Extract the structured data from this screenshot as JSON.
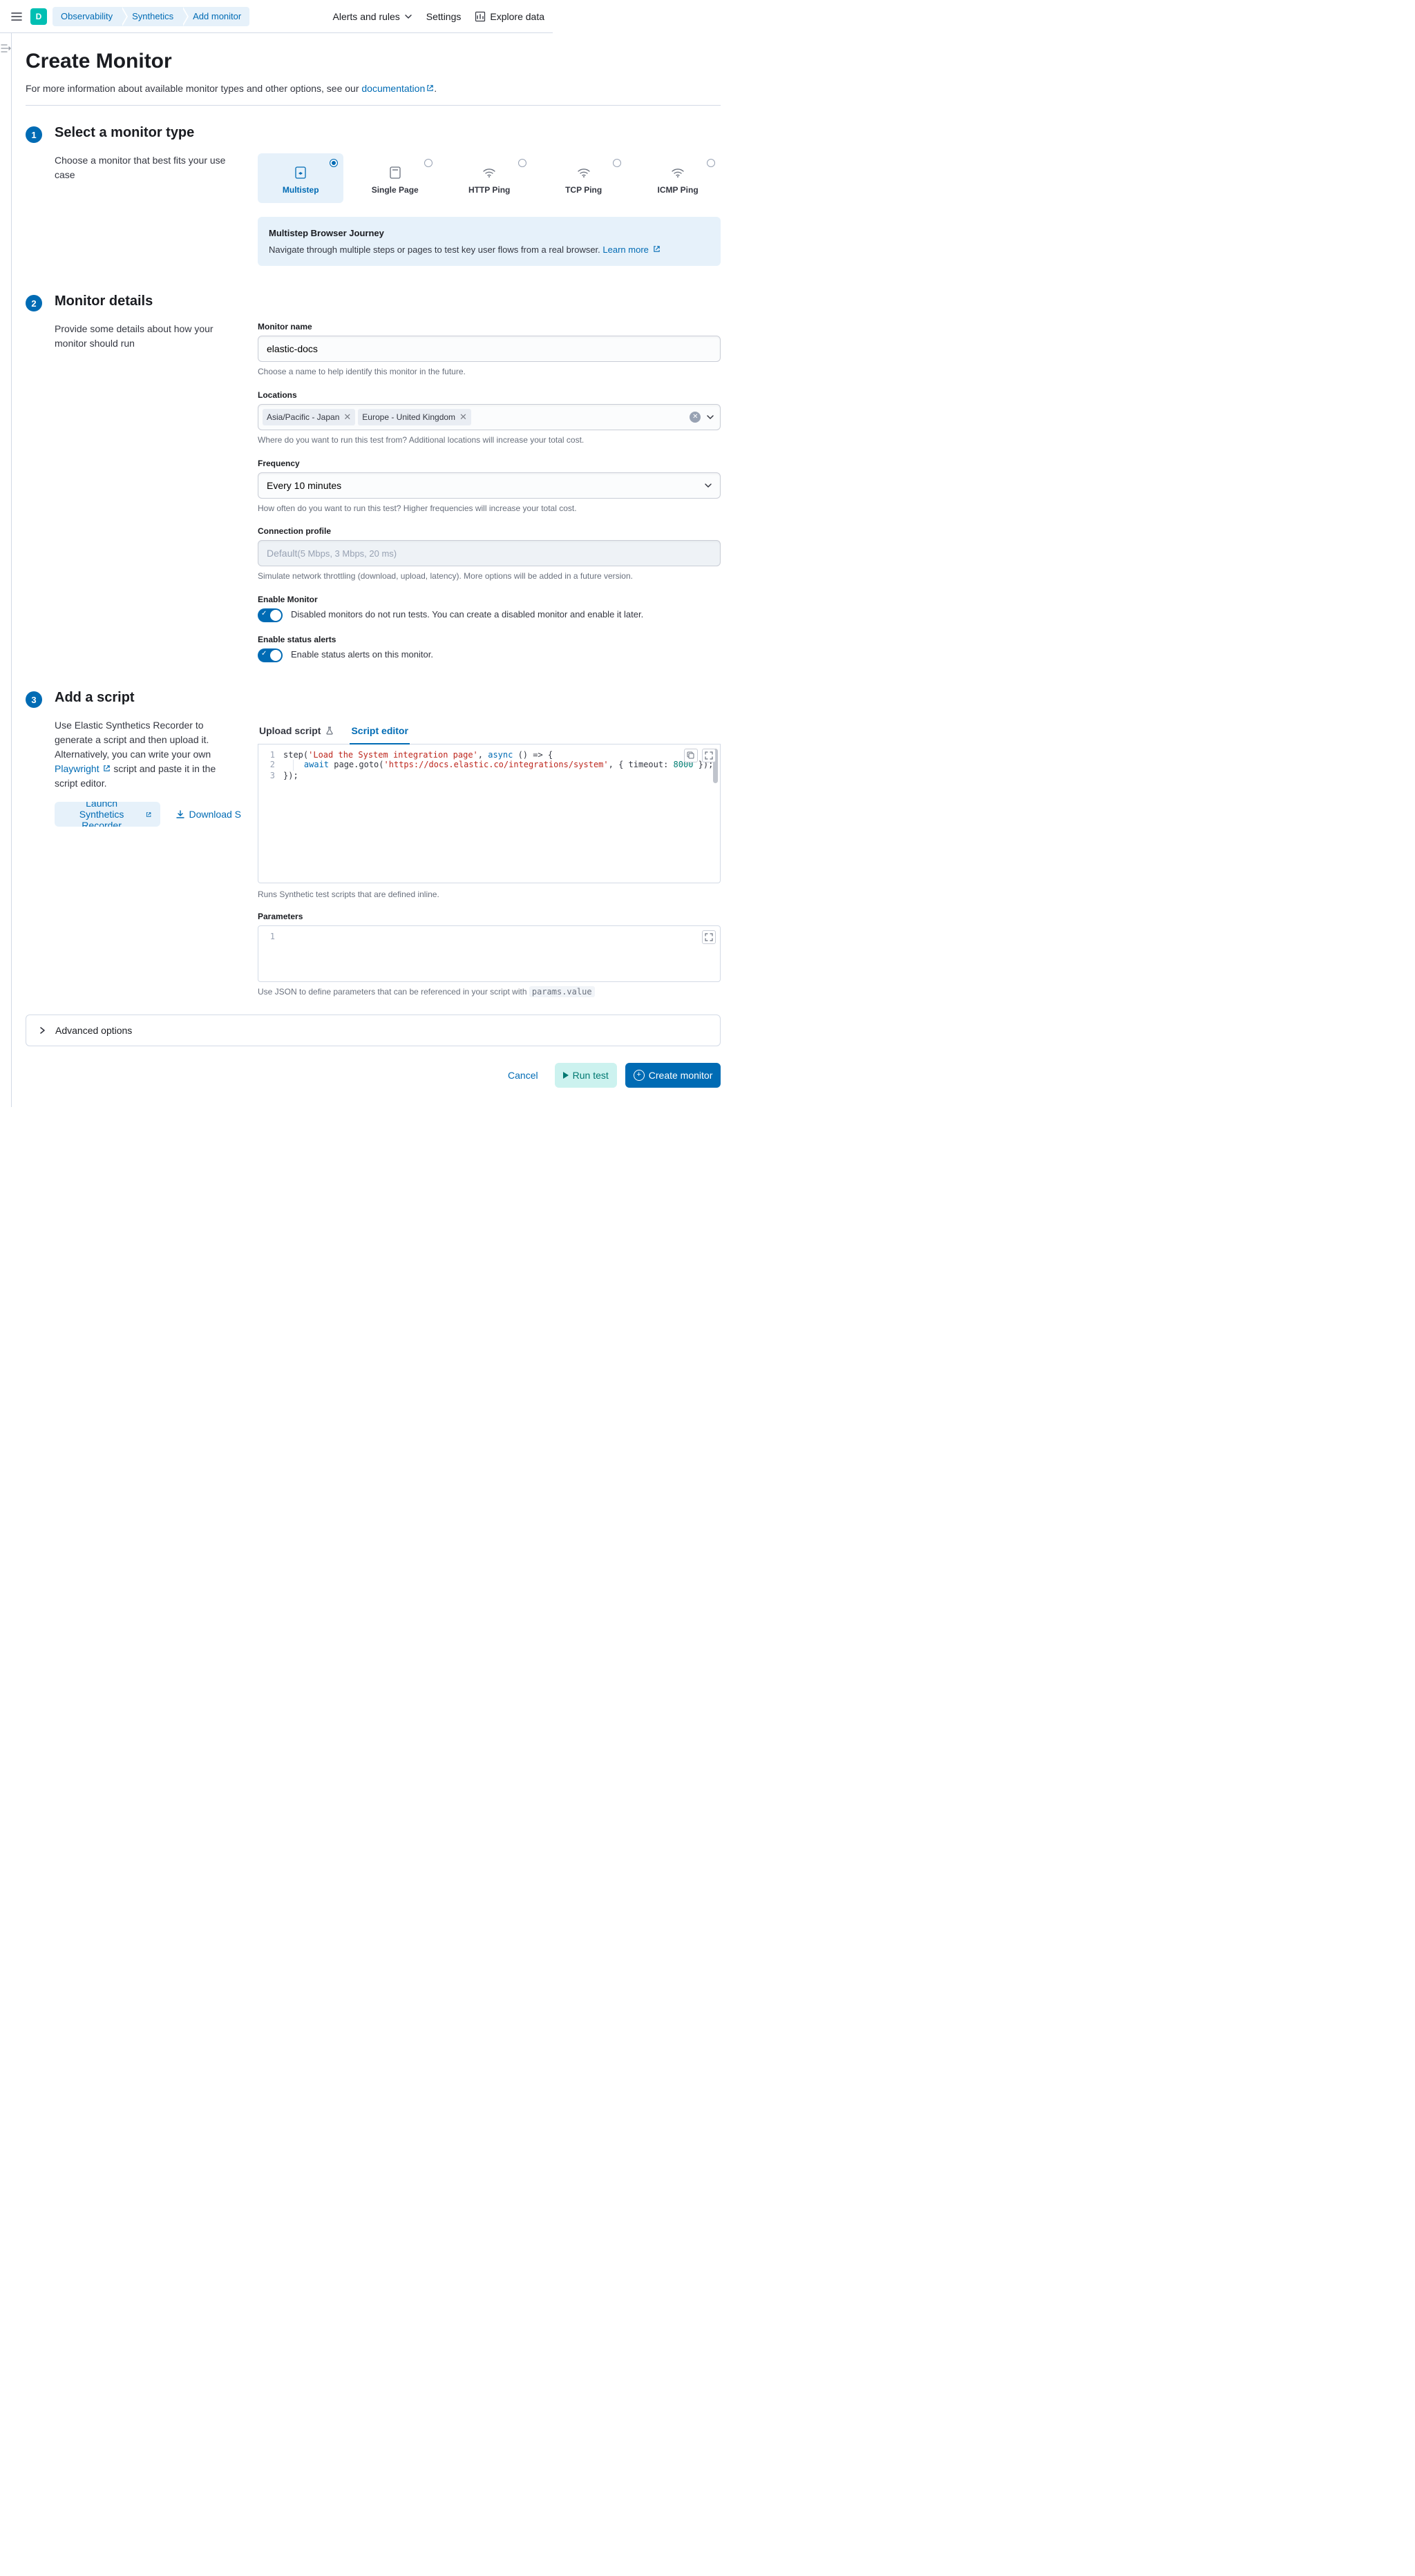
{
  "header": {
    "avatar_letter": "D",
    "breadcrumbs": [
      "Observability",
      "Synthetics",
      "Add monitor"
    ],
    "alerts": "Alerts and rules",
    "settings": "Settings",
    "explore": "Explore data"
  },
  "page": {
    "title": "Create Monitor",
    "intro_prefix": "For more information about available monitor types and other options, see our ",
    "intro_link": "documentation",
    "intro_suffix": "."
  },
  "step1": {
    "num": "1",
    "title": "Select a monitor type",
    "desc": "Choose a monitor that best fits your use case",
    "types": [
      "Multistep",
      "Single Page",
      "HTTP Ping",
      "TCP Ping",
      "ICMP Ping"
    ],
    "callout_title": "Multistep Browser Journey",
    "callout_text": "Navigate through multiple steps or pages to test key user flows from a real browser. ",
    "callout_link": "Learn more"
  },
  "step2": {
    "num": "2",
    "title": "Monitor details",
    "desc": "Provide some details about how your monitor should run",
    "name_label": "Monitor name",
    "name_value": "elastic-docs",
    "name_help": "Choose a name to help identify this monitor in the future.",
    "locations_label": "Locations",
    "location_tags": [
      "Asia/Pacific - Japan",
      "Europe - United Kingdom"
    ],
    "locations_help": "Where do you want to run this test from? Additional locations will increase your total cost.",
    "freq_label": "Frequency",
    "freq_value": "Every 10 minutes",
    "freq_help": "How often do you want to run this test? Higher frequencies will increase your total cost.",
    "conn_label": "Connection profile",
    "conn_main": "Default",
    "conn_sub": " (5 Mbps, 3 Mbps, 20 ms)",
    "conn_help": "Simulate network throttling (download, upload, latency). More options will be added in a future version.",
    "enable_label": "Enable Monitor",
    "enable_text": "Disabled monitors do not run tests. You can create a disabled monitor and enable it later.",
    "alerts_label": "Enable status alerts",
    "alerts_text": "Enable status alerts on this monitor."
  },
  "step3": {
    "num": "3",
    "title": "Add a script",
    "desc_l1": "Use Elastic Synthetics Recorder to generate a script and then upload it. Alternatively, you can write your own ",
    "desc_link": "Playwright",
    "desc_l2": " script and paste it in the script editor.",
    "launch_btn": "Launch Synthetics Recorder",
    "download_btn": "Download S",
    "tab_upload": "Upload script",
    "tab_editor": "Script editor",
    "code": {
      "l1a": "step(",
      "l1b": "'Load the System integration page'",
      "l1c": ", ",
      "l1d": "async",
      "l1e": " () => {",
      "l2a": "await",
      "l2b": " page.goto(",
      "l2c": "'https://docs.elastic.co/integrations/system'",
      "l2d": ", { timeout: ",
      "l2e": "8000",
      "l2f": " });",
      "l3": "});"
    },
    "code_help": "Runs Synthetic test scripts that are defined inline.",
    "params_label": "Parameters",
    "params_help_pre": "Use JSON to define parameters that can be referenced in your script with ",
    "params_help_code": "params.value"
  },
  "advanced": "Advanced options",
  "footer": {
    "cancel": "Cancel",
    "run": "Run test",
    "create": "Create monitor"
  }
}
